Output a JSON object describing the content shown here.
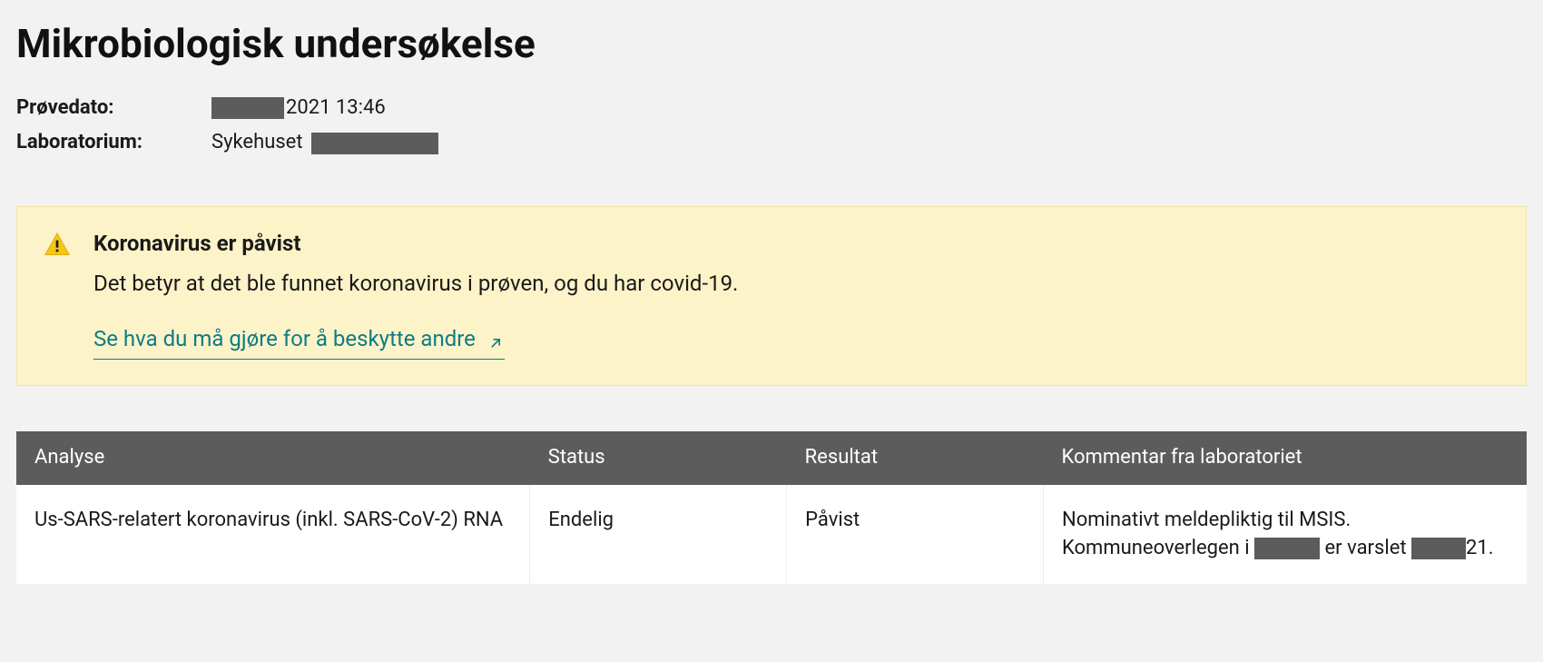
{
  "title": "Mikrobiologisk undersøkelse",
  "meta": {
    "date_label": "Prøvedato:",
    "date_value_suffix": "2021 13:46",
    "lab_label": "Laboratorium:",
    "lab_value_prefix": "Sykehuset"
  },
  "alert": {
    "title": "Koronavirus er påvist",
    "text": "Det betyr at det ble funnet koronavirus i prøven, og du har covid-19.",
    "link_text": "Se hva du må gjøre for å beskytte andre"
  },
  "table": {
    "headers": {
      "analyse": "Analyse",
      "status": "Status",
      "result": "Resultat",
      "comment": "Kommentar fra laboratoriet"
    },
    "rows": [
      {
        "analyse": "Us-SARS-relatert koronavirus (inkl. SARS-CoV-2) RNA",
        "status": "Endelig",
        "result": "Påvist",
        "comment_part1": "Nominativt meldepliktig til MSIS. Kommuneoverlegen i ",
        "comment_part2": " er vars­let ",
        "comment_part3": "21."
      }
    ]
  }
}
